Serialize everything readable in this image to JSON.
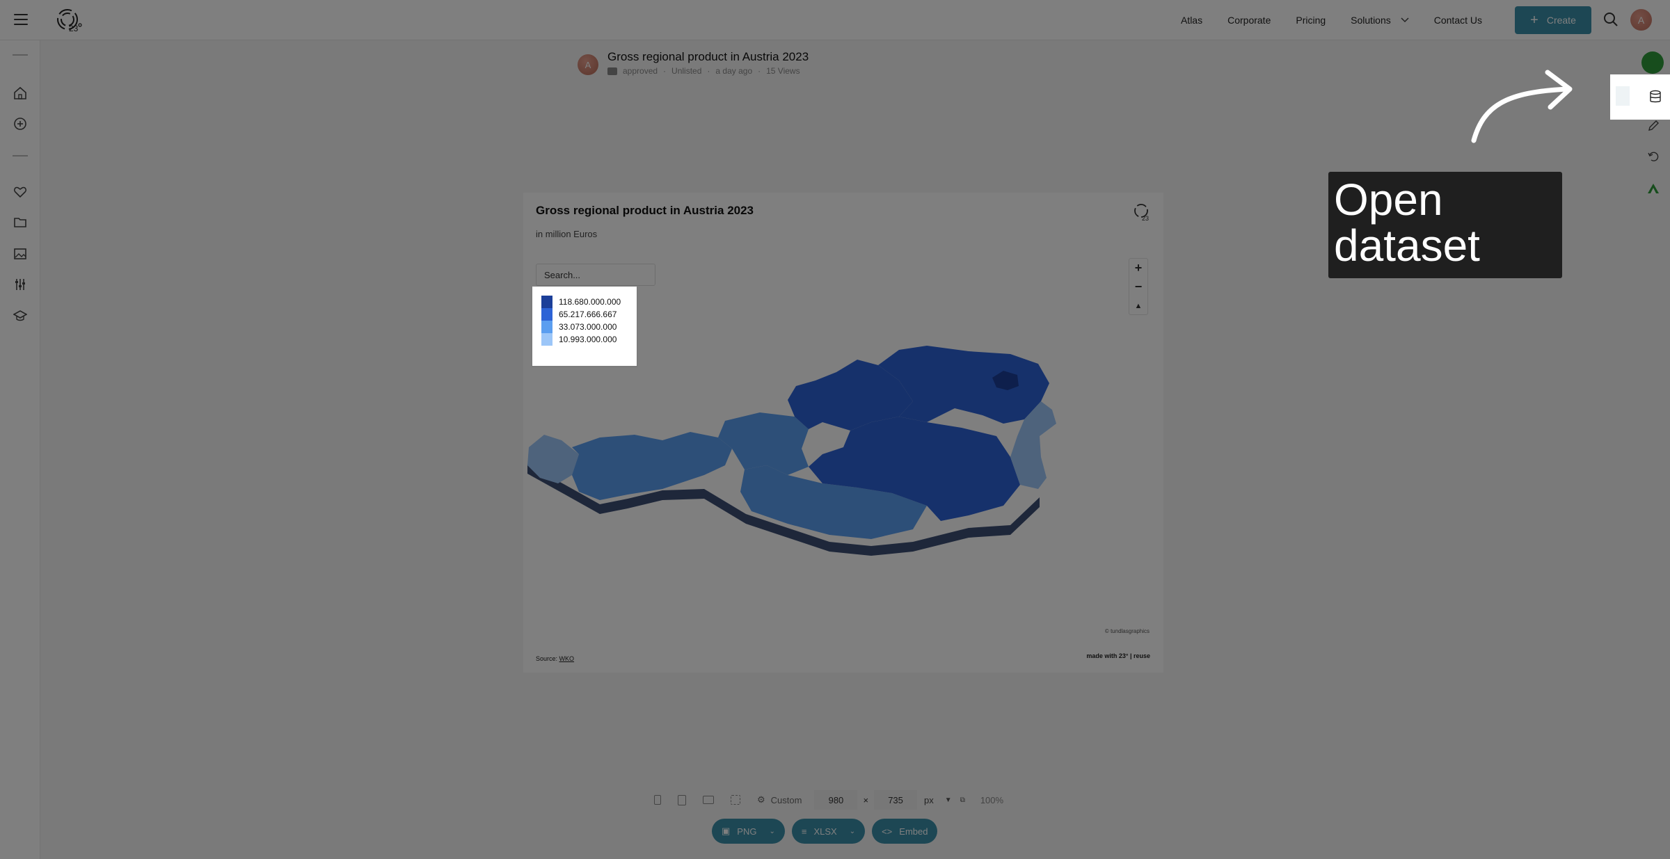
{
  "header": {
    "nav": [
      "Atlas",
      "Corporate",
      "Pricing",
      "Solutions",
      "Contact Us"
    ],
    "create_label": "Create",
    "avatar_initial": "A"
  },
  "title_block": {
    "avatar_initial": "A",
    "title": "Gross regional product in Austria 2023",
    "meta": [
      "approved",
      "Unlisted",
      "a day ago",
      "15 Views"
    ]
  },
  "chart": {
    "title": "Gross regional product in Austria 2023",
    "subtitle": "in million Euros",
    "search_placeholder": "Search...",
    "legend": [
      "118.680.000.000",
      "65.217.666.667",
      "33.073.000.000",
      "10.993.000.000"
    ],
    "credit": "© tundlasgraphics",
    "made_with": "made with 23° | reuse",
    "source_label": "Source:",
    "source_link": "WKO",
    "colors": {
      "darkest": "#1c3f99",
      "dark": "#2d63d6",
      "medium": "#5b9ef0",
      "light": "#9cc6f8",
      "lightest": "#c9e1fb"
    }
  },
  "size_bar": {
    "preset": "Custom",
    "width": "980",
    "times": "×",
    "height": "735",
    "unit": "px",
    "zoom": "100%"
  },
  "export": {
    "png": "PNG",
    "xlsx": "XLSX",
    "embed": "Embed"
  },
  "tooltip": {
    "text": "Open dataset"
  }
}
